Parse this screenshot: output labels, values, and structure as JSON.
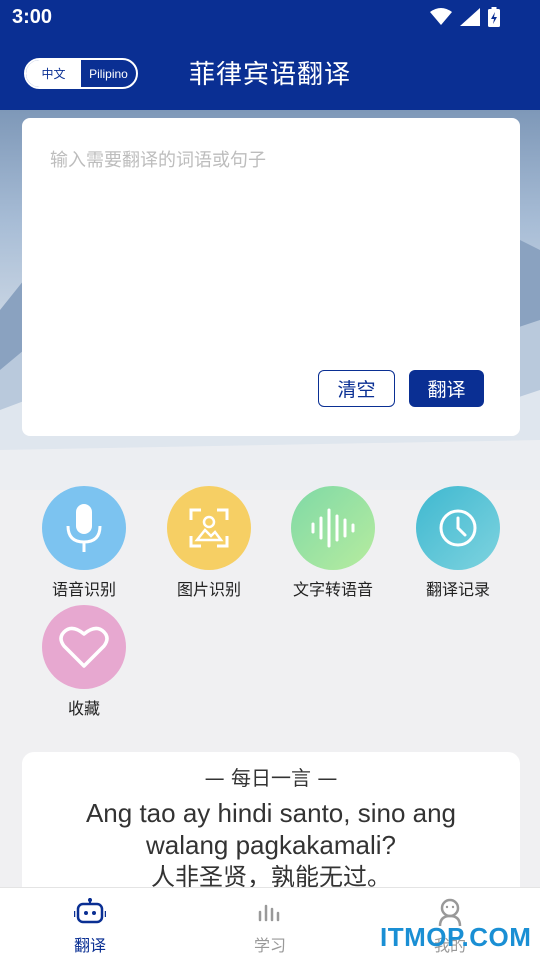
{
  "status_bar": {
    "time": "3:00"
  },
  "header": {
    "title": "菲律宾语翻译",
    "lang_left": "中文",
    "lang_right": "Pilipino"
  },
  "input_card": {
    "placeholder": "输入需要翻译的词语或句子",
    "clear_label": "清空",
    "translate_label": "翻译"
  },
  "features": [
    {
      "label": "语音识别",
      "icon": "microphone-icon",
      "color": "#7cc3f0"
    },
    {
      "label": "图片识别",
      "icon": "image-scan-icon",
      "color": "#f6cf64"
    },
    {
      "label": "文字转语音",
      "icon": "sound-wave-icon",
      "color": "#8ee0a0"
    },
    {
      "label": "翻译记录",
      "icon": "clock-icon",
      "color": "#4fc3d4"
    },
    {
      "label": "收藏",
      "icon": "heart-icon",
      "color": "#e7a8d0"
    }
  ],
  "daily_quote": {
    "title": "— 每日一言 —",
    "english": "Ang tao ay hindi santo, sino ang walang pagkakamali?",
    "chinese": "人非圣贤，孰能无过。"
  },
  "bottom_nav": {
    "items": [
      {
        "label": "翻译",
        "icon": "robot-icon",
        "active": true
      },
      {
        "label": "学习",
        "icon": "bars-icon",
        "active": false
      },
      {
        "label": "我的",
        "icon": "user-icon",
        "active": false
      }
    ]
  },
  "watermark": "ITMOP.COM",
  "colors": {
    "primary": "#0a2f93",
    "watermark": "#1a8fd4"
  }
}
